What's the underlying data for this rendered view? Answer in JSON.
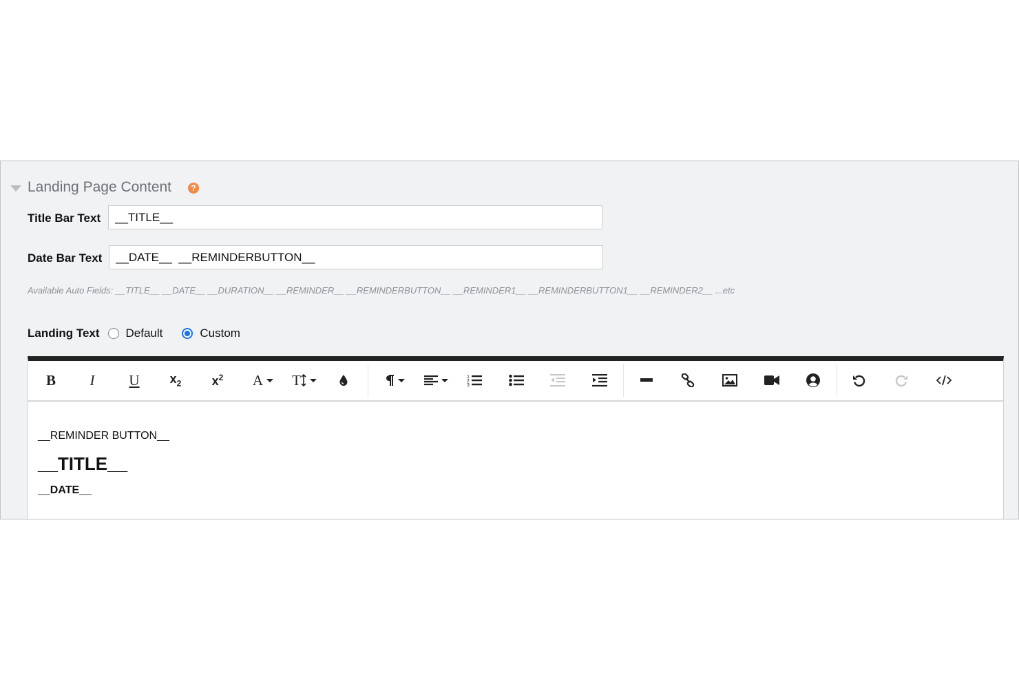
{
  "section": {
    "title": "Landing Page Content",
    "help_icon": "?"
  },
  "title_bar": {
    "label": "Title Bar Text",
    "value": "__TITLE__"
  },
  "date_bar": {
    "label": "Date Bar Text",
    "value": "__DATE__  __REMINDERBUTTON__"
  },
  "auto_fields_hint": "Available Auto Fields: __TITLE__ __DATE__ __DURATION__ __REMINDER__ __REMINDERBUTTON__ __REMINDER1__ __REMINDERBUTTON1__ __REMINDER2__ ...etc",
  "landing_text": {
    "label": "Landing Text",
    "options": [
      {
        "label": "Default",
        "checked": false
      },
      {
        "label": "Custom",
        "checked": true
      }
    ]
  },
  "editor": {
    "toolbar": {
      "bold": "B",
      "italic": "I",
      "underline": "U",
      "subscript": "x",
      "subscript_sub": "2",
      "superscript": "x",
      "superscript_sup": "2",
      "font_family": "A",
      "font_size": "T"
    },
    "content": {
      "line1": "__REMINDER BUTTON__",
      "title": "__TITLE__",
      "date": "__DATE__"
    },
    "accent_color": "#222222"
  },
  "colors": {
    "accent": "#1a73e8",
    "help": "#ef8a4b"
  }
}
